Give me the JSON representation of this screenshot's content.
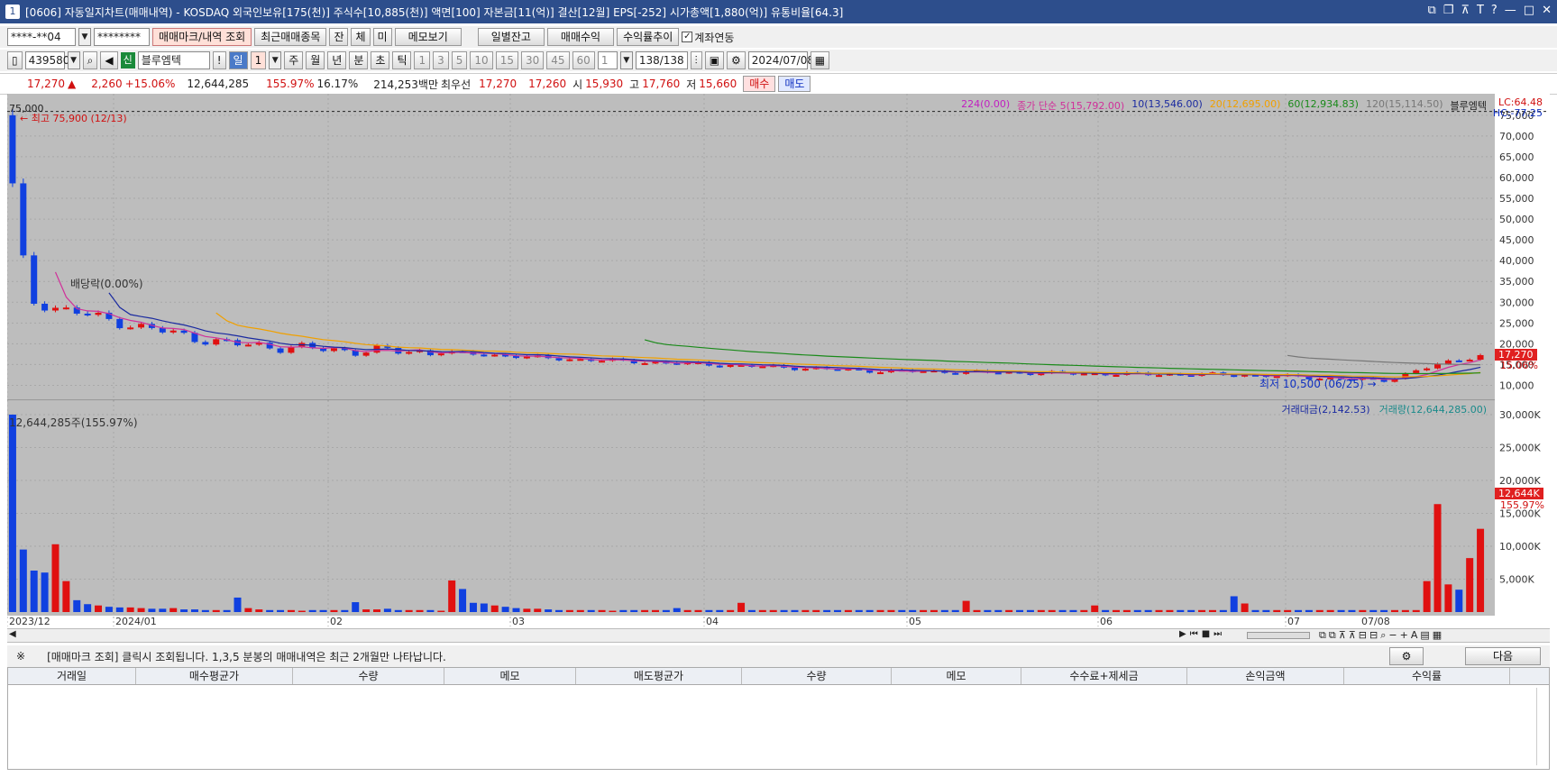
{
  "window": {
    "num": "1",
    "title": "[0606] 자동일지차트(매매내역) - KOSDAQ 외국인보유[175(천)] 주식수[10,885(천)] 액면[100] 자본금[11(억)] 결산[12월] EPS[-252] 시가총액[1,880(억)] 유통비율[64.3]"
  },
  "toolbar1": {
    "account": "****-**04",
    "password": "********",
    "buttons": [
      "매매마크/내역 조회",
      "최근매매종목",
      "잔",
      "체",
      "미",
      "메모보기",
      "일별잔고",
      "매매수익",
      "수익률추이"
    ],
    "checkbox_label": "계좌연동"
  },
  "toolbar2": {
    "code": "439580",
    "badge": "신",
    "name": "블루엠텍",
    "periods": [
      "일",
      "1",
      "주",
      "월",
      "년",
      "분",
      "초",
      "틱",
      "1",
      "3",
      "5",
      "10",
      "15",
      "30",
      "45",
      "60",
      "1"
    ],
    "count": "138",
    "total": "/138",
    "date": "2024/07/08"
  },
  "quote": {
    "price": "17,270",
    "arrow": "▲",
    "change": "2,260",
    "pct": "+15.06%",
    "volume": "12,644,285",
    "vol_ratio": "155.97%",
    "turnover": "16.17%",
    "amount": "214,253백만",
    "best_label": "최우선",
    "ask": "17,270",
    "bid": "17,260",
    "open_label": "시",
    "open": "15,930",
    "high_label": "고",
    "high": "17,760",
    "low_label": "저",
    "low": "15,660",
    "buy": "매수",
    "sell": "매도"
  },
  "chart_labels": {
    "top_price": "75,000",
    "ma_legend": [
      {
        "text": "224(0.00)",
        "color": "#c020c0"
      },
      {
        "text": "종가 단순 5(15,792.00)",
        "color": "#d0309a"
      },
      {
        "text": "10(13,546.00)",
        "color": "#1a2aa0"
      },
      {
        "text": "20(12,695.00)",
        "color": "#f0a000"
      },
      {
        "text": "60(12,934.83)",
        "color": "#1a8a1a"
      },
      {
        "text": "120(15,114.50)",
        "color": "#777777"
      },
      {
        "text": "블루엠텍",
        "color": "#222222"
      }
    ],
    "lc": "LC:64.48",
    "hc": "HC:-77.25",
    "high_note": "최고 75,900 (12/13)",
    "low_note": "최저 10,500 (06/25)",
    "dividend_note": "배당락(0.00%)",
    "vol_note": "12,644,285주(155.97%)",
    "vol_legend": [
      {
        "text": "거래대금(2,142.53)",
        "color": "#1a2aa0"
      },
      {
        "text": "거래량(12,644,285.00)",
        "color": "#1a8a8a"
      }
    ],
    "price_badge": "17,270",
    "price_pct": "15.06%",
    "vol_badge": "12,644K",
    "vol_pct": "155.97%"
  },
  "chart_data": {
    "type": "candlestick",
    "y_ticks": [
      "75,000",
      "70,000",
      "65,000",
      "60,000",
      "55,000",
      "50,000",
      "45,000",
      "40,000",
      "35,000",
      "30,000",
      "25,000",
      "20,000",
      "15,000",
      "10,000"
    ],
    "vol_ticks": [
      "30,000K",
      "25,000K",
      "20,000K",
      "15,000K",
      "10,000K",
      "5,000K"
    ],
    "x_labels": [
      "2023/12",
      "2024/01",
      "02",
      "03",
      "04",
      "05",
      "06",
      "07",
      "07/08"
    ],
    "ylim": [
      10000,
      75900
    ],
    "price_trend": [
      [
        0,
        52000
      ],
      [
        2,
        30000
      ],
      [
        6,
        27500
      ],
      [
        12,
        24000
      ],
      [
        20,
        20000
      ],
      [
        30,
        18500
      ],
      [
        40,
        18000
      ],
      [
        50,
        16500
      ],
      [
        60,
        15500
      ],
      [
        80,
        13500
      ],
      [
        100,
        12800
      ],
      [
        115,
        12500
      ],
      [
        128,
        11200
      ],
      [
        133,
        15000
      ],
      [
        137,
        17270
      ]
    ],
    "volume_k": [
      30000,
      9500,
      6300,
      6000,
      10300,
      4700,
      1800,
      1200,
      1000,
      800,
      700,
      700,
      600,
      500,
      500,
      600,
      400,
      400,
      300,
      300,
      300,
      2200,
      600,
      400,
      300,
      300,
      300,
      200,
      300,
      300,
      300,
      300,
      1500,
      400,
      400,
      500,
      300,
      300,
      300,
      300,
      200,
      4800,
      3500,
      1400,
      1300,
      1000,
      800,
      600,
      500,
      500,
      400,
      300,
      300,
      300,
      300,
      300,
      200,
      300,
      300,
      300,
      300,
      300,
      600,
      300,
      300,
      300,
      300,
      300,
      1400,
      300,
      300,
      300,
      300,
      300,
      300,
      300,
      300,
      300,
      300,
      300,
      300,
      300,
      300,
      300,
      300,
      300,
      300,
      300,
      300,
      1700,
      300,
      300,
      300,
      300,
      300,
      300,
      300,
      300,
      300,
      300,
      300,
      1000,
      300,
      300,
      300,
      300,
      300,
      300,
      300,
      300,
      300,
      300,
      300,
      300,
      2400,
      1300,
      300,
      300,
      300,
      300,
      300,
      300,
      300,
      300,
      300,
      300,
      300,
      300,
      300,
      300,
      300,
      300,
      4700,
      16400,
      4200,
      3400,
      8200,
      12644
    ]
  },
  "notice": {
    "mark": "※",
    "text": "[매매마크 조회] 클릭시 조회됩니다. 1,3,5 분봉의 매매내역은 최근 2개월만 나타납니다.",
    "next": "다음"
  },
  "grid": {
    "columns": [
      "거래일",
      "매수평균가",
      "수량",
      "메모",
      "매도평균가",
      "수량",
      "메모",
      "수수료+제세금",
      "손익금액",
      "수익률"
    ]
  }
}
